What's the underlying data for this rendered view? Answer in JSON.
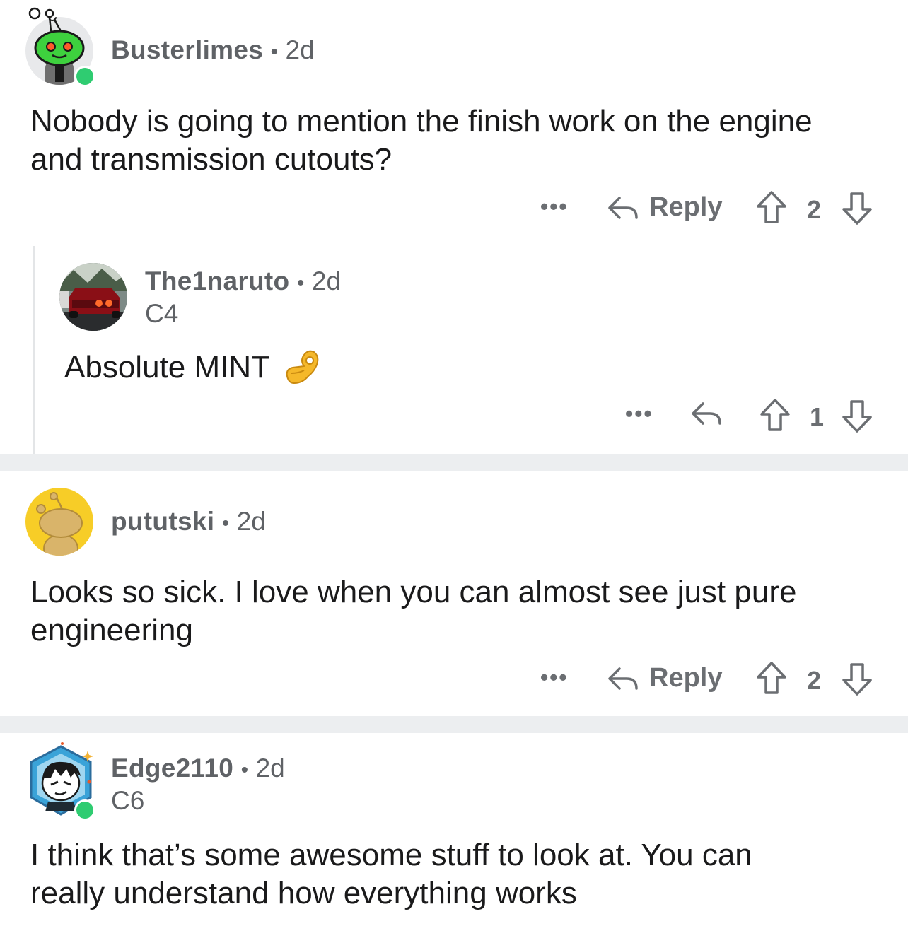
{
  "comments": [
    {
      "username": "Busterlimes",
      "age": "2d",
      "flair": "",
      "body_line1": "Nobody is going to mention the finish work on the engine",
      "body_line2": "and transmission cutouts?",
      "reply_label": "Reply",
      "score": "2",
      "online": true
    },
    {
      "username": "The1naruto",
      "age": "2d",
      "flair": "C4",
      "body": "Absolute MINT",
      "emoji": "👌",
      "score": "1"
    },
    {
      "username": "pututski",
      "age": "2d",
      "flair": "",
      "body_line1": "Looks so sick. I love when you can almost see just pure",
      "body_line2": "engineering",
      "reply_label": "Reply",
      "score": "2"
    },
    {
      "username": "Edge2110",
      "age": "2d",
      "flair": "C6",
      "body_line1": "I think that’s some awesome stuff to look at. You can",
      "body_line2": "really understand how everything works",
      "online": true
    }
  ],
  "separator": "•",
  "more_label": "•••",
  "colors": {
    "online": "#2fcc71",
    "meta_text": "#5f6266",
    "divider": "#eceef0"
  }
}
